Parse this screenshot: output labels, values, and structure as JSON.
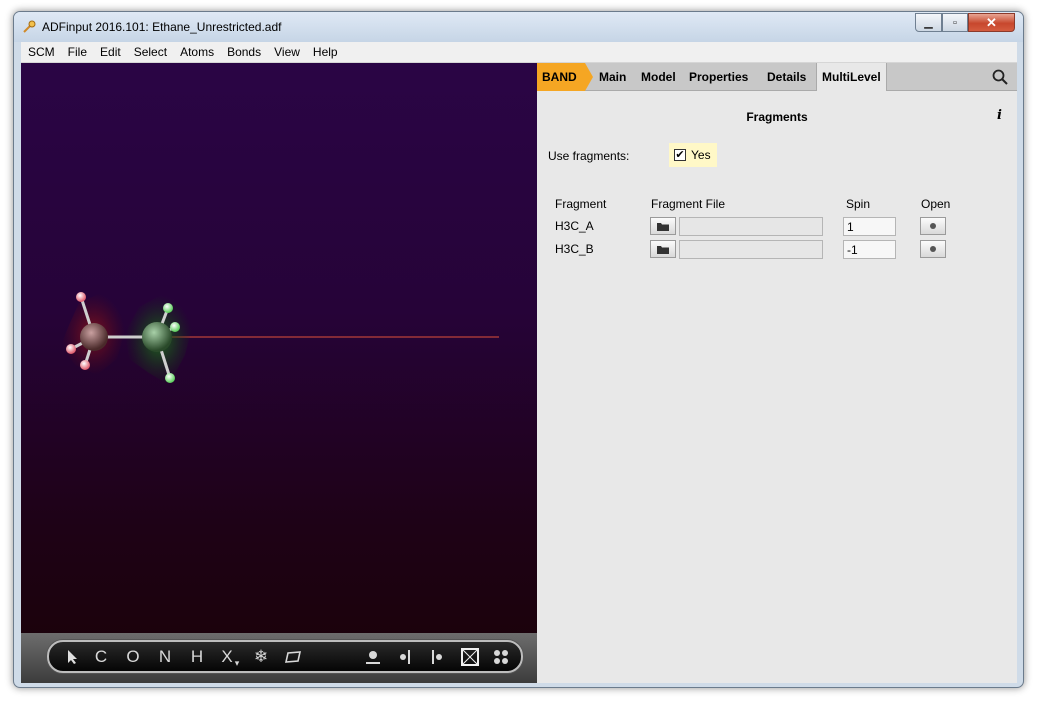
{
  "window": {
    "title": "ADFinput 2016.101: Ethane_Unrestricted.adf"
  },
  "menu": [
    "SCM",
    "File",
    "Edit",
    "Select",
    "Atoms",
    "Bonds",
    "View",
    "Help"
  ],
  "toolbar": {
    "tools": [
      "C",
      "O",
      "N",
      "H",
      "X"
    ]
  },
  "tabs": {
    "band": "BAND",
    "items": [
      "Main",
      "Model",
      "Properties",
      "Details",
      "MultiLevel"
    ],
    "active": "MultiLevel"
  },
  "panel": {
    "title": "Fragments",
    "use_fragments_label": "Use fragments:",
    "use_fragments_value": "Yes",
    "use_fragments_checked": true,
    "headers": {
      "fragment": "Fragment",
      "file": "Fragment File",
      "spin": "Spin",
      "open": "Open"
    },
    "rows": [
      {
        "name": "H3C_A",
        "file": "",
        "spin": "1"
      },
      {
        "name": "H3C_B",
        "file": "",
        "spin": "-1"
      }
    ]
  },
  "colors": {
    "band_tab": "#f5a623",
    "fragment_a": "#b02a3a",
    "fragment_b": "#2c7a2c",
    "axis_line": "#e0503a"
  },
  "icons": [
    "app-icon",
    "minimize-icon",
    "maximize-icon",
    "close-icon",
    "search-icon",
    "info-icon",
    "folder-icon",
    "select-arrow-icon",
    "snowflake-icon",
    "plane-icon",
    "atom-icon",
    "bond-left-icon",
    "bond-right-icon",
    "frame-icon",
    "group-icon"
  ]
}
